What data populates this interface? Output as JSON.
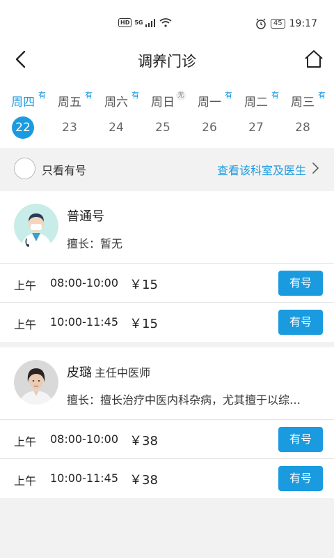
{
  "status_bar": {
    "left_badge": "HD",
    "left_net": "5G",
    "battery": "45",
    "time": "19:17"
  },
  "header": {
    "title": "调养门诊"
  },
  "days": [
    {
      "weekday": "周四",
      "tag": "有",
      "date": "22",
      "selected": true
    },
    {
      "weekday": "周五",
      "tag": "有",
      "date": "23",
      "selected": false
    },
    {
      "weekday": "周六",
      "tag": "有",
      "date": "24",
      "selected": false
    },
    {
      "weekday": "周日",
      "tag": "无",
      "date": "25",
      "selected": false
    },
    {
      "weekday": "周一",
      "tag": "有",
      "date": "26",
      "selected": false
    },
    {
      "weekday": "周二",
      "tag": "有",
      "date": "27",
      "selected": false
    },
    {
      "weekday": "周三",
      "tag": "有",
      "date": "28",
      "selected": false
    }
  ],
  "filter": {
    "only_available_label": "只看有号",
    "view_department_link": "查看该科室及医生"
  },
  "doctors": [
    {
      "name": "普通号",
      "title": "",
      "specialty": "擅长：暂无",
      "slots": [
        {
          "period": "上午",
          "time": "08:00-10:00",
          "price": "￥15",
          "button": "有号"
        },
        {
          "period": "上午",
          "time": "10:00-11:45",
          "price": "￥15",
          "button": "有号"
        }
      ]
    },
    {
      "name": "皮璐",
      "title": "主任中医师",
      "specialty": "擅长：擅长治疗中医内科杂病，尤其擅于以综…",
      "slots": [
        {
          "period": "上午",
          "time": "08:00-10:00",
          "price": "￥38",
          "button": "有号"
        },
        {
          "period": "上午",
          "time": "10:00-11:45",
          "price": "￥38",
          "button": "有号"
        }
      ]
    }
  ],
  "colors": {
    "accent": "#1a9be0",
    "background": "#f2f2f2"
  }
}
